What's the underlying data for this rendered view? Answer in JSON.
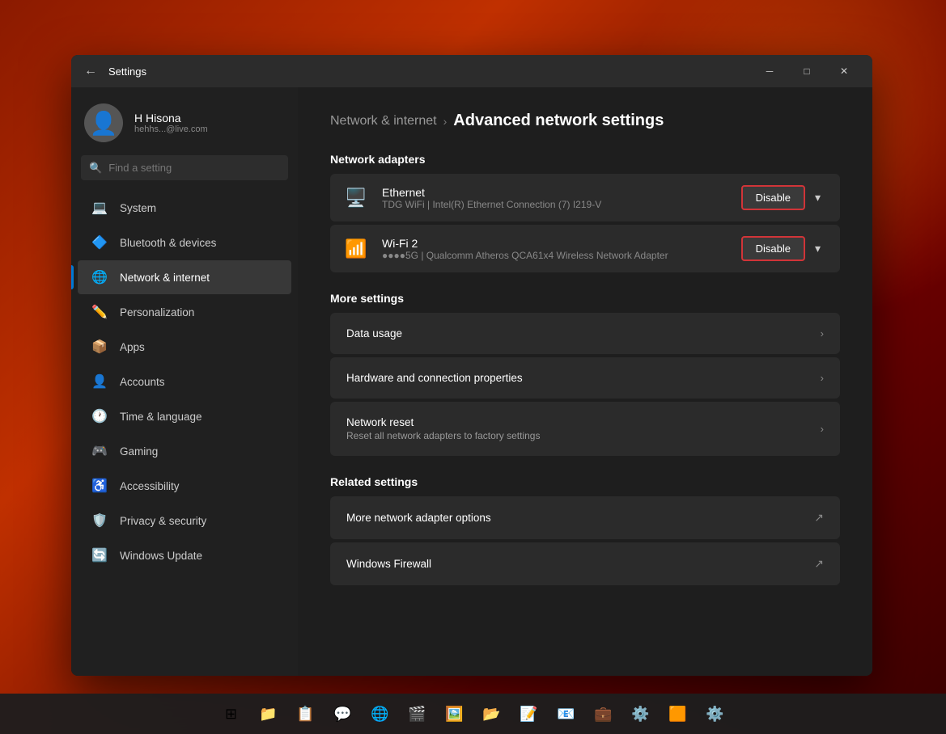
{
  "window": {
    "title": "Settings",
    "titlebar": {
      "minimize_label": "─",
      "maximize_label": "□",
      "close_label": "✕"
    }
  },
  "sidebar": {
    "back_button": "←",
    "user": {
      "name": "H Hisona",
      "email": "hehhs...@live.com"
    },
    "search_placeholder": "Find a setting",
    "items": [
      {
        "id": "system",
        "label": "System",
        "icon": "💻",
        "active": false
      },
      {
        "id": "bluetooth",
        "label": "Bluetooth & devices",
        "icon": "🔷",
        "active": false
      },
      {
        "id": "network",
        "label": "Network & internet",
        "icon": "🌐",
        "active": true
      },
      {
        "id": "personalization",
        "label": "Personalization",
        "icon": "✏️",
        "active": false
      },
      {
        "id": "apps",
        "label": "Apps",
        "icon": "📦",
        "active": false
      },
      {
        "id": "accounts",
        "label": "Accounts",
        "icon": "👤",
        "active": false
      },
      {
        "id": "time",
        "label": "Time & language",
        "icon": "🕐",
        "active": false
      },
      {
        "id": "gaming",
        "label": "Gaming",
        "icon": "🎮",
        "active": false
      },
      {
        "id": "accessibility",
        "label": "Accessibility",
        "icon": "♿",
        "active": false
      },
      {
        "id": "privacy",
        "label": "Privacy & security",
        "icon": "🛡️",
        "active": false
      },
      {
        "id": "update",
        "label": "Windows Update",
        "icon": "🔄",
        "active": false
      }
    ]
  },
  "main": {
    "breadcrumb_parent": "Network & internet",
    "breadcrumb_separator": "›",
    "breadcrumb_current": "Advanced network settings",
    "sections": {
      "adapters": {
        "title": "Network adapters",
        "items": [
          {
            "id": "ethernet",
            "icon": "🖥️",
            "name": "Ethernet",
            "description": "TDG WiFi | Intel(R) Ethernet Connection (7) I219-V",
            "button_label": "Disable"
          },
          {
            "id": "wifi2",
            "icon": "📶",
            "name": "Wi-Fi 2",
            "description": "●●●●5G | Qualcomm Atheros QCA61x4 Wireless Network Adapter",
            "button_label": "Disable"
          }
        ]
      },
      "more_settings": {
        "title": "More settings",
        "items": [
          {
            "id": "data-usage",
            "title": "Data usage",
            "subtitle": "",
            "type": "arrow"
          },
          {
            "id": "hw-connection",
            "title": "Hardware and connection properties",
            "subtitle": "",
            "type": "arrow"
          },
          {
            "id": "network-reset",
            "title": "Network reset",
            "subtitle": "Reset all network adapters to factory settings",
            "type": "arrow"
          }
        ]
      },
      "related": {
        "title": "Related settings",
        "items": [
          {
            "id": "more-adapter",
            "title": "More network adapter options",
            "subtitle": "",
            "type": "external"
          },
          {
            "id": "firewall",
            "title": "Windows Firewall",
            "subtitle": "",
            "type": "external"
          }
        ]
      }
    }
  },
  "taskbar": {
    "items": [
      {
        "id": "start",
        "icon": "⊞",
        "label": "Start"
      },
      {
        "id": "explorer",
        "icon": "📁",
        "label": "File Explorer"
      },
      {
        "id": "apps2",
        "icon": "📋",
        "label": "Apps"
      },
      {
        "id": "teams",
        "icon": "💬",
        "label": "Teams"
      },
      {
        "id": "chrome",
        "icon": "🌐",
        "label": "Chrome"
      },
      {
        "id": "premiere",
        "icon": "🎬",
        "label": "Premiere Pro"
      },
      {
        "id": "ps",
        "icon": "🖼️",
        "label": "Photoshop"
      },
      {
        "id": "files",
        "icon": "📂",
        "label": "Files"
      },
      {
        "id": "notepad",
        "icon": "📝",
        "label": "Notepad"
      },
      {
        "id": "mail",
        "icon": "📧",
        "label": "Mail"
      },
      {
        "id": "slack",
        "icon": "💼",
        "label": "Slack"
      },
      {
        "id": "unknown1",
        "icon": "⚙️",
        "label": "Settings"
      },
      {
        "id": "office",
        "icon": "🟧",
        "label": "Office"
      },
      {
        "id": "settings2",
        "icon": "⚙️",
        "label": "Settings2"
      }
    ]
  }
}
